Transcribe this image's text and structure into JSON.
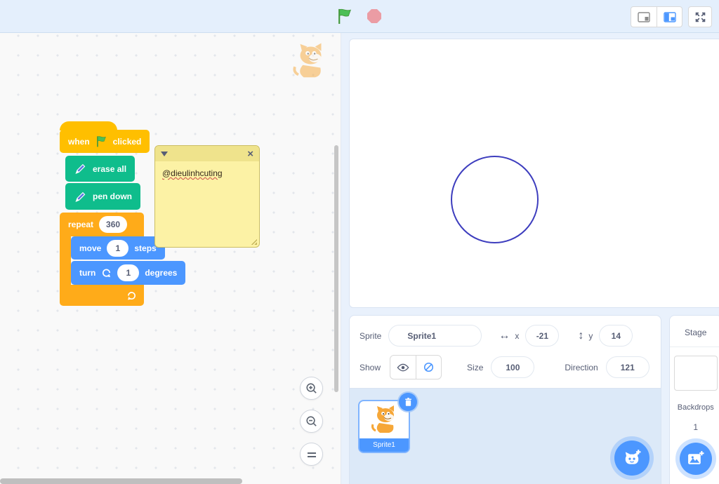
{
  "topbar": {},
  "workspace": {
    "blocks": {
      "when_clicked": {
        "prefix": "when",
        "suffix": "clicked"
      },
      "erase_all": {
        "label": "erase all"
      },
      "pen_down": {
        "label": "pen down"
      },
      "repeat": {
        "label": "repeat",
        "value": "360"
      },
      "move": {
        "label": "move",
        "value": "1",
        "suffix": "steps"
      },
      "turn": {
        "label": "turn",
        "value": "1",
        "suffix": "degrees"
      }
    },
    "comment": {
      "text": "@dieulinhcuting"
    }
  },
  "stage": {
    "drawing": {
      "type": "circle-outline",
      "stroke": "#3D3DBE"
    }
  },
  "sprite_panel": {
    "sprite_label": "Sprite",
    "sprite_name": "Sprite1",
    "x_label": "x",
    "x_value": "-21",
    "y_label": "y",
    "y_value": "14",
    "show_label": "Show",
    "size_label": "Size",
    "size_value": "100",
    "direction_label": "Direction",
    "direction_value": "121"
  },
  "sprite_list": {
    "selected_sprite_name": "Sprite1"
  },
  "stage_column": {
    "title": "Stage",
    "backdrops_label": "Backdrops",
    "backdrops_count": "1"
  },
  "icons": {
    "horizontal_range": "↔",
    "vertical_range": "↕",
    "close": "×"
  },
  "colors": {
    "events_block": "#FFBF00",
    "control_block": "#FFAB19",
    "pen_block": "#0FBD8C",
    "motion_block": "#4C97FF",
    "accent_blue": "#4C97FF",
    "comment_bg": "#FCF2A5",
    "flag_green": "#4CBF56",
    "stop_red": "#EB9CA4",
    "circle_stroke": "#3D3DBE",
    "topbar_bg": "#E4EFFC",
    "panel_bg": "#E9F1FC"
  }
}
